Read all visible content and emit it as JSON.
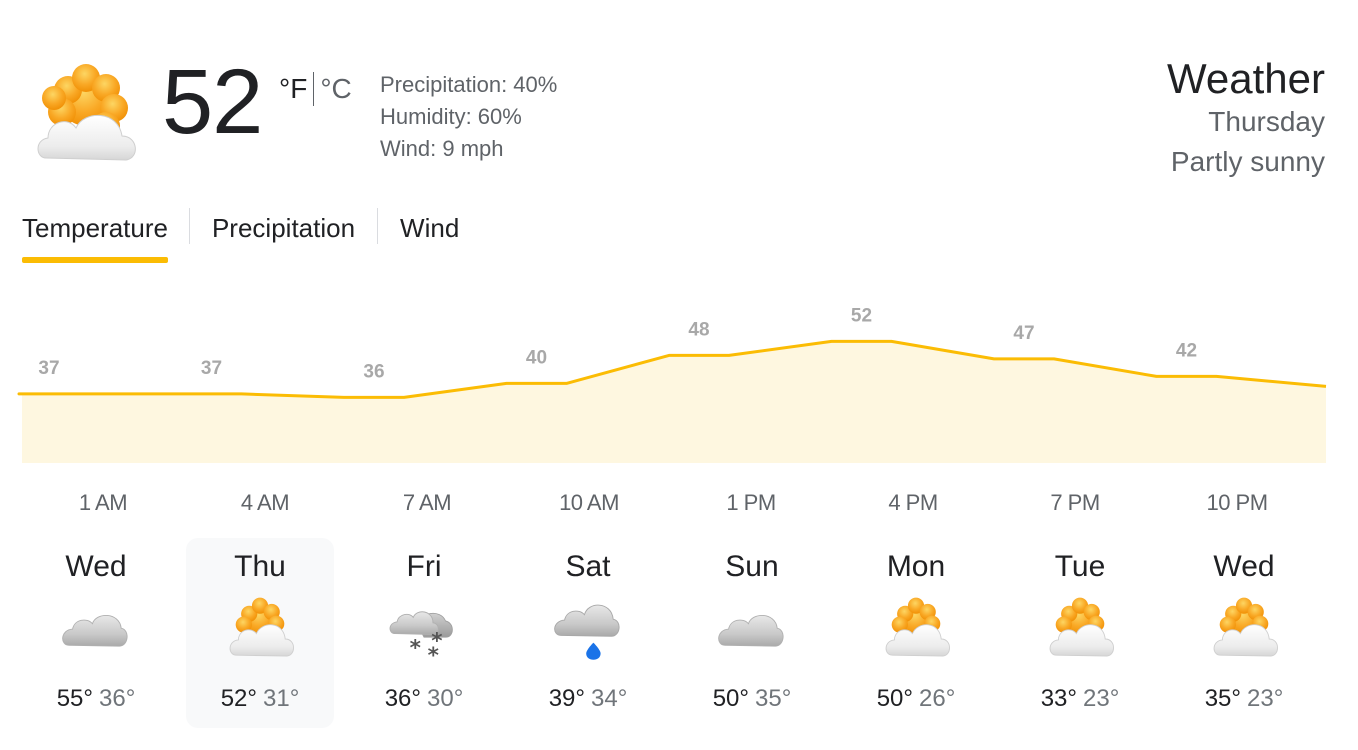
{
  "current": {
    "icon": "partly-sunny-icon",
    "temperature": "52",
    "unit_f": "°F",
    "unit_c": "°C",
    "precipitation": "Precipitation: 40%",
    "humidity": "Humidity: 60%",
    "wind": "Wind: 9 mph"
  },
  "header": {
    "title": "Weather",
    "day": "Thursday",
    "condition": "Partly sunny"
  },
  "tabs": [
    {
      "label": "Temperature",
      "selected": true
    },
    {
      "label": "Precipitation",
      "selected": false
    },
    {
      "label": "Wind",
      "selected": false
    }
  ],
  "chart_data": {
    "type": "area",
    "series": [
      {
        "values": [
          37,
          37,
          36,
          40,
          48,
          52,
          47,
          42
        ]
      }
    ],
    "x": [
      "1 AM",
      "4 AM",
      "7 AM",
      "10 AM",
      "1 PM",
      "4 PM",
      "7 PM",
      "10 PM"
    ],
    "data_labels": [
      "37",
      "37",
      "36",
      "40",
      "48",
      "52",
      "47",
      "42"
    ],
    "line_color": "#fbbc04",
    "fill_color": "#fef7e0"
  },
  "forecast": [
    {
      "day": "Wed",
      "icon": "cloudy-icon",
      "high": "55°",
      "low": "36°",
      "selected": false
    },
    {
      "day": "Thu",
      "icon": "partly-sunny-icon",
      "high": "52°",
      "low": "31°",
      "selected": true
    },
    {
      "day": "Fri",
      "icon": "snow-icon",
      "high": "36°",
      "low": "30°",
      "selected": false
    },
    {
      "day": "Sat",
      "icon": "rain-icon",
      "high": "39°",
      "low": "34°",
      "selected": false
    },
    {
      "day": "Sun",
      "icon": "cloudy-icon",
      "high": "50°",
      "low": "35°",
      "selected": false
    },
    {
      "day": "Mon",
      "icon": "partly-sunny-icon",
      "high": "50°",
      "low": "26°",
      "selected": false
    },
    {
      "day": "Tue",
      "icon": "partly-sunny-icon",
      "high": "33°",
      "low": "23°",
      "selected": false
    },
    {
      "day": "Wed",
      "icon": "partly-sunny-icon",
      "high": "35°",
      "low": "23°",
      "selected": false
    }
  ]
}
